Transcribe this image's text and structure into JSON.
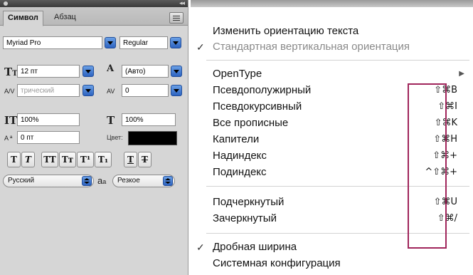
{
  "panel": {
    "tabs": [
      "Символ",
      "Абзац"
    ],
    "font_family": "Myriad Pro",
    "font_style": "Regular",
    "font_size": "12 пт",
    "leading": "(Авто)",
    "kerning": "трический",
    "tracking": "0",
    "vertical_scale": "100%",
    "horizontal_scale": "100%",
    "baseline_shift": "0 пт",
    "color_label": "Цвет:",
    "text_color": "#000000",
    "language": "Русский",
    "antialias_icon_text": "a",
    "antialias_icon_sub": "a",
    "antialias": "Резкое",
    "style_buttons": [
      {
        "name": "faux-bold-button",
        "label": "T"
      },
      {
        "name": "faux-italic-button",
        "label": "T"
      },
      {
        "name": "all-caps-button",
        "label": "TT"
      },
      {
        "name": "small-caps-button",
        "label": "Tт"
      },
      {
        "name": "superscript-button",
        "label": "T¹"
      },
      {
        "name": "subscript-button",
        "label": "T₁"
      },
      {
        "name": "underline-button",
        "label": "T"
      },
      {
        "name": "strikethrough-button",
        "label": "T"
      }
    ]
  },
  "menu": {
    "items": [
      {
        "label": "Изменить ориентацию текста",
        "check": "",
        "shortcut": "",
        "disabled": false
      },
      {
        "label": "Стандартная вертикальная ориентация",
        "check": "✓",
        "shortcut": "",
        "disabled": true
      },
      {
        "label": "OpenType",
        "check": "",
        "shortcut": "",
        "disabled": false,
        "submenu": true
      },
      {
        "label": "Псевдополужирный",
        "check": "",
        "shortcut": "⇧⌘B",
        "disabled": false
      },
      {
        "label": "Псевдокурсивный",
        "check": "",
        "shortcut": "⇧⌘I",
        "disabled": false
      },
      {
        "label": "Все прописные",
        "check": "",
        "shortcut": "⇧⌘K",
        "disabled": false
      },
      {
        "label": "Капители",
        "check": "",
        "shortcut": "⇧⌘H",
        "disabled": false
      },
      {
        "label": "Надиндекс",
        "check": "",
        "shortcut": "⇧⌘+",
        "disabled": false
      },
      {
        "label": "Подиндекс",
        "check": "",
        "shortcut": "^⇧⌘+",
        "disabled": false
      },
      {
        "label": "Подчеркнутый",
        "check": "",
        "shortcut": "⇧⌘U",
        "disabled": false
      },
      {
        "label": "Зачеркнутый",
        "check": "",
        "shortcut": "⇧⌘/",
        "disabled": false
      },
      {
        "label": "Дробная ширина",
        "check": "✓",
        "shortcut": "",
        "disabled": false
      },
      {
        "label": "Системная конфигурация",
        "check": "",
        "shortcut": "",
        "disabled": false
      }
    ],
    "submenu_arrow": "▶"
  },
  "colors": {
    "highlight_border": "#a0255b",
    "drop_blue": "#2d63c0"
  }
}
